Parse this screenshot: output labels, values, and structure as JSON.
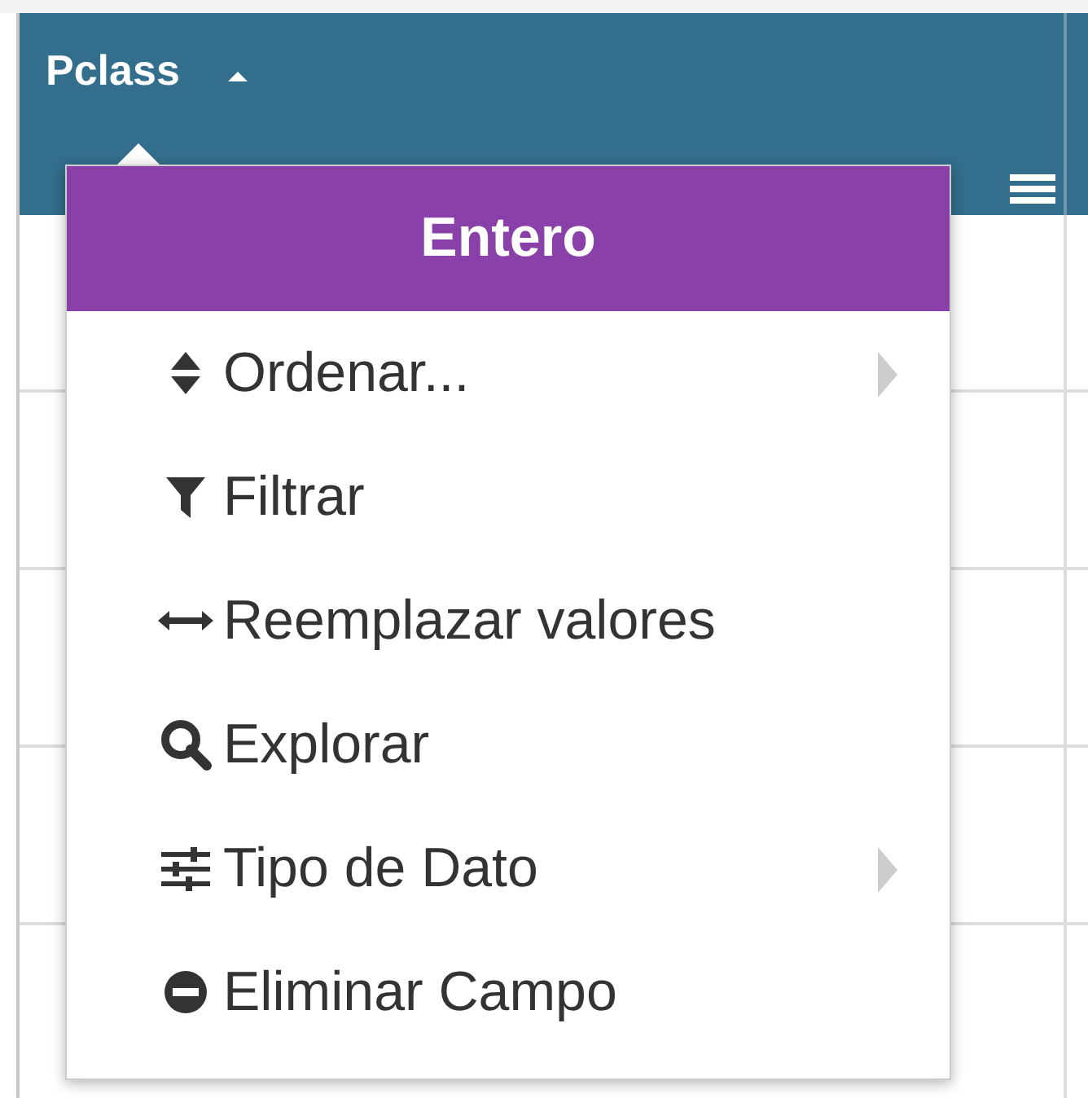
{
  "column_header": {
    "label": "Pclass",
    "sorted_ascending": true
  },
  "menu": {
    "title": "Entero",
    "items": [
      {
        "label": "Ordenar...",
        "submenu": true
      },
      {
        "label": "Filtrar",
        "submenu": false
      },
      {
        "label": "Reemplazar valores",
        "submenu": false
      },
      {
        "label": "Explorar",
        "submenu": false
      },
      {
        "label": "Tipo de Dato",
        "submenu": true
      },
      {
        "label": "Eliminar Campo",
        "submenu": false
      }
    ]
  }
}
